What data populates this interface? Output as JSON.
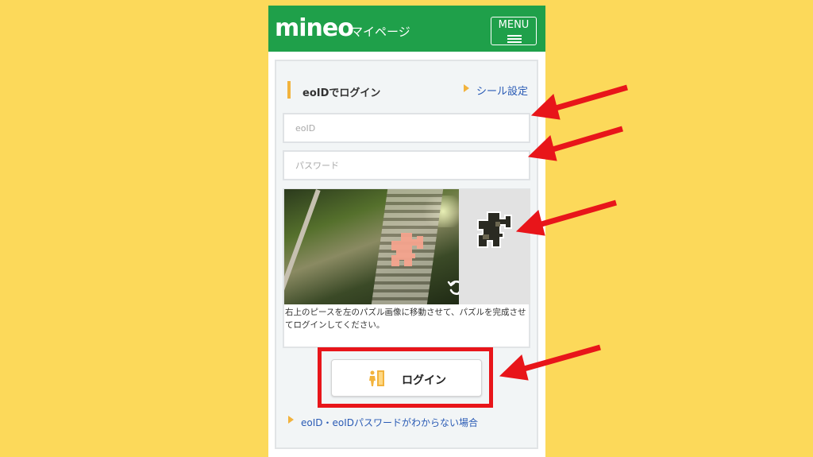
{
  "header": {
    "logo": "mineo",
    "page_title": "マイページ",
    "menu_label": "MENU",
    "menu_icon": "hamburger-icon"
  },
  "login": {
    "heading": "eoIDでログイン",
    "seal_link": "シール設定",
    "eoid_placeholder": "eoID",
    "password_placeholder": "パスワード",
    "captcha_instruction": "右上のピースを左のパズル画像に移動させて、パズルを完成させてログインしてください。",
    "refresh_icon": "refresh-icon",
    "login_button": "ログイン",
    "login_icon": "door-person-icon",
    "help_link": "eoID・eoIDパスワードがわからない場合"
  },
  "colors": {
    "background": "#fcd95a",
    "header_green": "#1fa04a",
    "accent_orange": "#f2b33d",
    "link_blue": "#2a5bb5",
    "annotation_red": "#e8151a",
    "puzzle_slot": "#f4a38d"
  }
}
